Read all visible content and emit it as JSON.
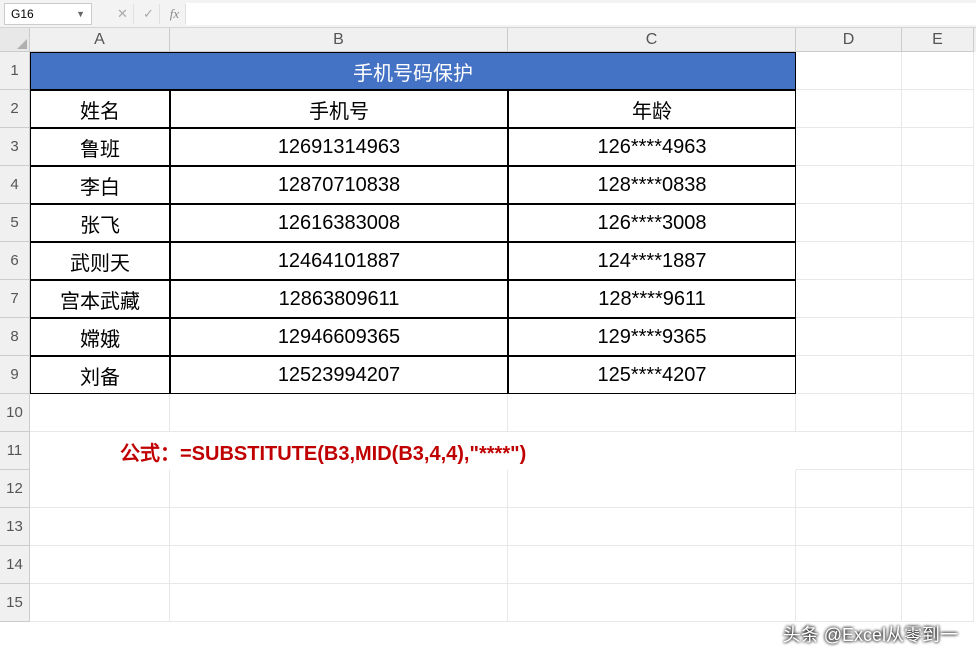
{
  "nameBox": {
    "ref": "G16"
  },
  "fx": {
    "cancel": "✕",
    "confirm": "✓",
    "label": "fx"
  },
  "columns": [
    "A",
    "B",
    "C",
    "D",
    "E"
  ],
  "rowNums": [
    "1",
    "2",
    "3",
    "4",
    "5",
    "6",
    "7",
    "8",
    "9",
    "10",
    "11",
    "12",
    "13",
    "14",
    "15"
  ],
  "title": "手机号码保护",
  "headers": {
    "name": "姓名",
    "phone": "手机号",
    "age": "年龄"
  },
  "data": [
    {
      "name": "鲁班",
      "phone": "12691314963",
      "masked": "126****4963"
    },
    {
      "name": "李白",
      "phone": "12870710838",
      "masked": "128****0838"
    },
    {
      "name": "张飞",
      "phone": "12616383008",
      "masked": "126****3008"
    },
    {
      "name": "武则天",
      "phone": "12464101887",
      "masked": "124****1887"
    },
    {
      "name": "宫本武藏",
      "phone": "12863809611",
      "masked": "128****9611"
    },
    {
      "name": "嫦娥",
      "phone": "12946609365",
      "masked": "129****9365"
    },
    {
      "name": "刘备",
      "phone": "12523994207",
      "masked": "125****4207"
    }
  ],
  "formulaNote": "公式：=SUBSTITUTE(B3,MID(B3,4,4),\"****\")",
  "watermark": "头条 @Excel从零到一",
  "chart_data": {
    "type": "table",
    "title": "手机号码保护",
    "columns": [
      "姓名",
      "手机号",
      "年龄"
    ],
    "rows": [
      [
        "鲁班",
        "12691314963",
        "126****4963"
      ],
      [
        "李白",
        "12870710838",
        "128****0838"
      ],
      [
        "张飞",
        "12616383008",
        "126****3008"
      ],
      [
        "武则天",
        "12464101887",
        "124****1887"
      ],
      [
        "宫本武藏",
        "12863809611",
        "128****9611"
      ],
      [
        "嫦娥",
        "12946609365",
        "129****9365"
      ],
      [
        "刘备",
        "12523994207",
        "125****4207"
      ]
    ],
    "annotation": "公式：=SUBSTITUTE(B3,MID(B3,4,4),\"****\")"
  }
}
